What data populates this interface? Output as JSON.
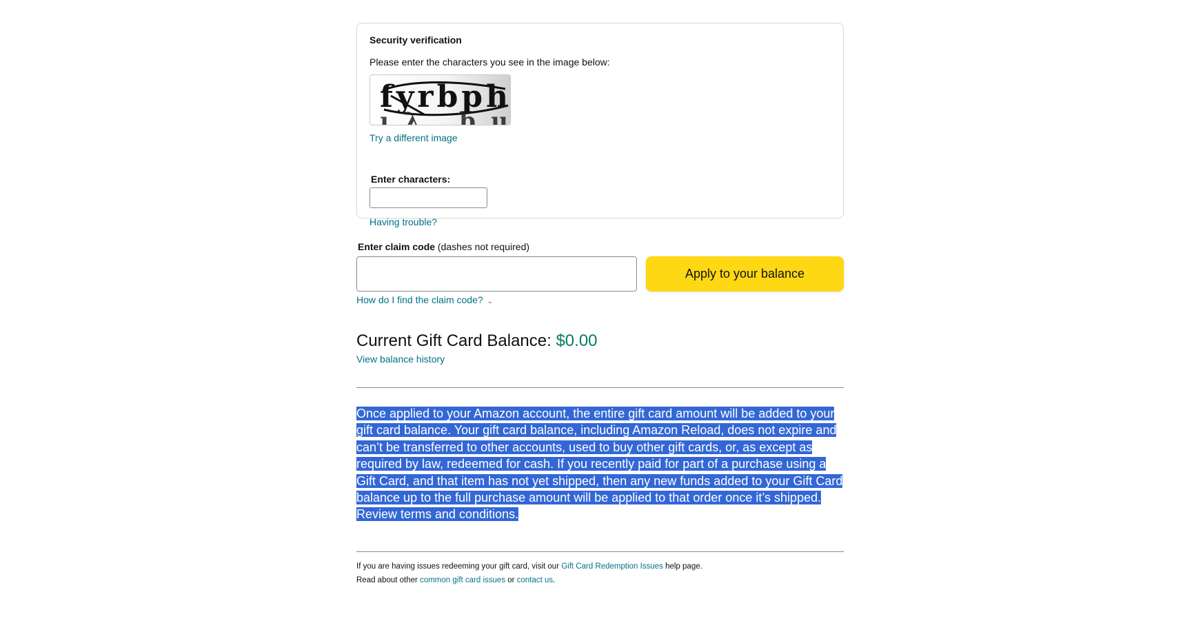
{
  "security": {
    "title": "Security verification",
    "instruction": "Please enter the characters you see in the image below:",
    "captcha_text": "fyrbph",
    "try_different": "Try a different image",
    "enter_label": "Enter characters:",
    "enter_value": "",
    "having_trouble": "Having trouble?"
  },
  "claim": {
    "label_bold": "Enter claim code",
    "label_hint": " (dashes not required)",
    "input_value": "",
    "apply_button": "Apply to your balance",
    "find_link": "How do I find the claim code?",
    "find_chevron": "⌄"
  },
  "balance": {
    "label": "Current Gift Card Balance: ",
    "amount": "$0.00",
    "history_link": "View balance history"
  },
  "terms": {
    "text": "Once applied to your Amazon account, the entire gift card amount will be added to your gift card balance. Your gift card balance, including Amazon Reload, does not expire and can’t be transferred to other accounts, used to buy other gift cards, or, as except as required by law, redeemed for cash. If you recently paid for part of a purchase using a Gift Card, and that item has not yet shipped, then any new funds added to your Gift Card balance up to the full purchase amount will be applied to that order once it’s shipped. Review terms and conditions."
  },
  "footer": {
    "part1": "If you are having issues redeeming your gift card, visit our ",
    "link1": "Gift Card Redemption Issues",
    "part2": " help page. Read about other ",
    "link2": "common gift card issues",
    "part3": " or ",
    "link3": "contact us",
    "part4": "."
  },
  "colors": {
    "link": "#007185",
    "button": "#ffd814",
    "balance_amount": "#067d62",
    "selection": "#3367d6"
  }
}
